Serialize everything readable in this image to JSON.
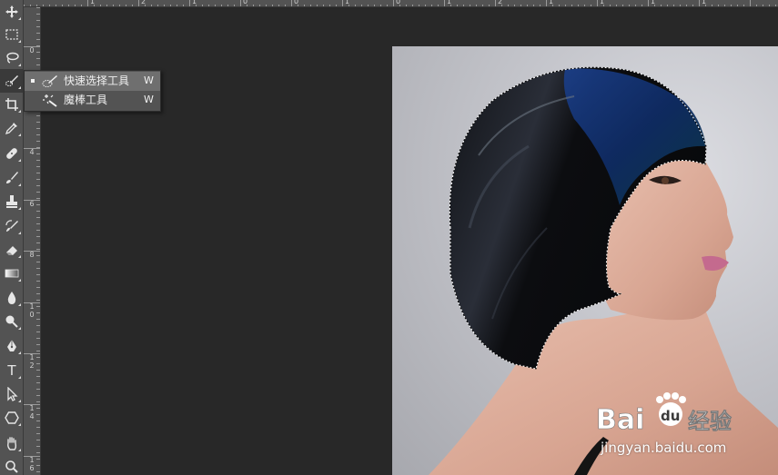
{
  "window": {
    "app": "Photoshop"
  },
  "toolbar": {
    "tools": [
      {
        "name": "move-tool",
        "icon": "move-icon"
      },
      {
        "name": "rectangular-marquee-tool",
        "icon": "marquee-icon"
      },
      {
        "name": "lasso-tool",
        "icon": "lasso-icon"
      },
      {
        "name": "quick-selection-tool",
        "icon": "quick-selection-icon",
        "active": true
      },
      {
        "name": "crop-tool",
        "icon": "crop-icon"
      },
      {
        "name": "eyedropper-tool",
        "icon": "eyedropper-icon"
      },
      {
        "name": "healing-brush-tool",
        "icon": "bandage-icon"
      },
      {
        "name": "brush-tool",
        "icon": "brush-icon"
      },
      {
        "name": "clone-stamp-tool",
        "icon": "stamp-icon"
      },
      {
        "name": "history-brush-tool",
        "icon": "history-brush-icon"
      },
      {
        "name": "eraser-tool",
        "icon": "eraser-icon"
      },
      {
        "name": "gradient-tool",
        "icon": "gradient-icon"
      },
      {
        "name": "blur-tool",
        "icon": "drop-icon"
      },
      {
        "name": "dodge-tool",
        "icon": "dodge-icon"
      },
      {
        "name": "pen-tool",
        "icon": "pen-icon"
      },
      {
        "name": "type-tool",
        "icon": "type-icon"
      },
      {
        "name": "path-selection-tool",
        "icon": "arrow-icon"
      },
      {
        "name": "shape-tool",
        "icon": "hexagon-icon"
      },
      {
        "name": "hand-tool",
        "icon": "hand-icon"
      },
      {
        "name": "zoom-tool",
        "icon": "zoom-icon"
      }
    ],
    "type_glyph": "T"
  },
  "flyout": {
    "items": [
      {
        "label": "快速选择工具",
        "shortcut": "W",
        "icon": "quick-selection-icon",
        "selected": true
      },
      {
        "label": "魔棒工具",
        "shortcut": "W",
        "icon": "magic-wand-icon",
        "selected": false
      }
    ]
  },
  "rulers": {
    "top_labels": [
      "1",
      "2",
      "1",
      "0",
      "0",
      "1",
      "0",
      "1",
      "2",
      "1",
      "1",
      "1",
      "1"
    ],
    "left_labels": [
      "0",
      "2",
      "4",
      "6",
      "8",
      "1\n0",
      "1\n2",
      "1\n4",
      "1\n6"
    ]
  },
  "document": {
    "selection_active": true
  },
  "watermark": {
    "brand": "Bai",
    "brand_paw": "du",
    "brand_cn": "经验",
    "url": "jingyan.baidu.com"
  },
  "colors": {
    "panel": "#535353",
    "canvas": "#282828",
    "flyout_highlight": "#6f6f6f"
  }
}
